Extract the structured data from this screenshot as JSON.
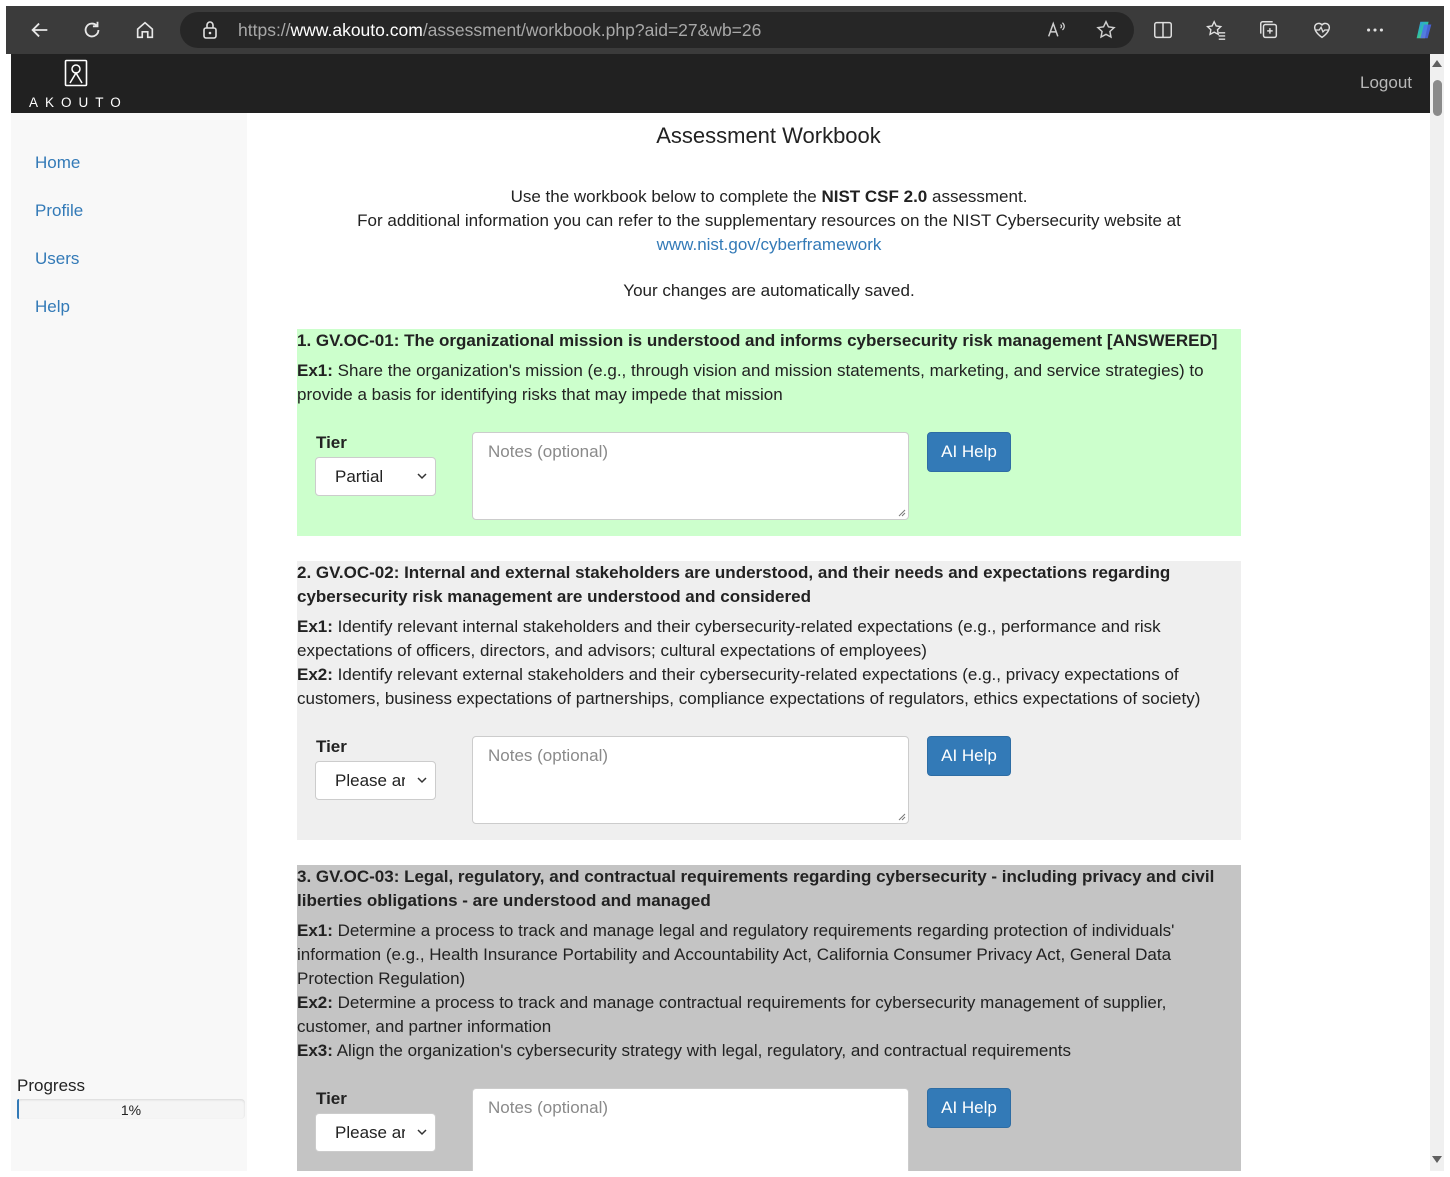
{
  "browser": {
    "url_prefix": "https://",
    "url_host": "www.akouto.com",
    "url_path": "/assessment/workbook.php?aid=27&wb=26"
  },
  "header": {
    "brand": "AKOUTO",
    "logout": "Logout"
  },
  "sidebar": {
    "items": [
      {
        "label": "Home"
      },
      {
        "label": "Profile"
      },
      {
        "label": "Users"
      },
      {
        "label": "Help"
      }
    ],
    "progress_label": "Progress",
    "progress_value": "1%",
    "progress_fraction": 0.01
  },
  "main": {
    "title": "Assessment Workbook",
    "intro_1_pre": "Use the workbook below to complete the ",
    "intro_1_bold": "NIST CSF 2.0",
    "intro_1_post": " assessment.",
    "intro_2": "For additional information you can refer to the supplementary resources on the NIST Cybersecurity website at",
    "intro_link": "www.nist.gov/cyberframework",
    "saved_note": "Your changes are automatically saved."
  },
  "items": [
    {
      "title": "1. GV.OC-01: The organizational mission is understood and informs cybersecurity risk management [ANSWERED]",
      "examples": [
        {
          "label": "Ex1:",
          "text": " Share the organization's mission (e.g., through vision and mission statements, marketing, and service strategies) to provide a basis for identifying risks that may impede that mission"
        }
      ],
      "tier_label": "Tier",
      "tier_value": "Partial",
      "notes_placeholder": "Notes (optional)",
      "ai_help": "AI Help",
      "color": "#ccffcc"
    },
    {
      "title": "2. GV.OC-02: Internal and external stakeholders are understood, and their needs and expectations regarding cybersecurity risk management are understood and considered",
      "examples": [
        {
          "label": "Ex1:",
          "text": " Identify relevant internal stakeholders and their cybersecurity-related expectations (e.g., performance and risk expectations of officers, directors, and advisors; cultural expectations of employees)"
        },
        {
          "label": "Ex2:",
          "text": " Identify relevant external stakeholders and their cybersecurity-related expectations (e.g., privacy expectations of customers, business expectations of partnerships, compliance expectations of regulators, ethics expectations of society)"
        }
      ],
      "tier_label": "Tier",
      "tier_value": "Please ar",
      "notes_placeholder": "Notes (optional)",
      "ai_help": "AI Help",
      "color": "#efefef"
    },
    {
      "title": "3. GV.OC-03: Legal, regulatory, and contractual requirements regarding cybersecurity - including privacy and civil liberties obligations - are understood and managed",
      "examples": [
        {
          "label": "Ex1:",
          "text": " Determine a process to track and manage legal and regulatory requirements regarding protection of individuals' information (e.g., Health Insurance Portability and Accountability Act, California Consumer Privacy Act, General Data Protection Regulation)"
        },
        {
          "label": "Ex2:",
          "text": " Determine a process to track and manage contractual requirements for cybersecurity management of supplier, customer, and partner information"
        },
        {
          "label": "Ex3:",
          "text": " Align the organization's cybersecurity strategy with legal, regulatory, and contractual requirements"
        }
      ],
      "tier_label": "Tier",
      "tier_value": "Please ar",
      "notes_placeholder": "Notes (optional)",
      "ai_help": "AI Help",
      "color": "#c4c4c4"
    }
  ]
}
